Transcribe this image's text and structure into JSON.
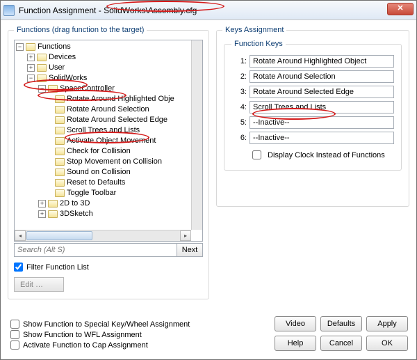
{
  "window": {
    "title_prefix": "Function Assignment - ",
    "title_path": "SolidWorks\\Assembly.cfg",
    "close_glyph": "✕"
  },
  "left": {
    "legend": "Functions (drag function to the target)",
    "tree_root": "Functions",
    "nodes": {
      "devices": "Devices",
      "user": "User",
      "solidworks": "SolidWorks",
      "spacecontroller": "SpaceController",
      "2dto3d": "2D to 3D",
      "3dsketch": "3DSketch"
    },
    "sc_children": [
      "Rotate Around Highlighted Obje",
      "Rotate Around Selection",
      "Rotate Around Selected Edge",
      "Scroll Trees and Lists",
      "Activate Object Movement",
      "Check for Collision",
      "Stop Movement on Collision",
      "Sound on Collision",
      "Reset to Defaults",
      "Toggle Toolbar"
    ],
    "search_placeholder": "Search (Alt S)",
    "next_label": "Next",
    "filter_label": "Filter Function List",
    "edit_label": "Edit …"
  },
  "right": {
    "legend": "Keys Assignment",
    "sublegend": "Function Keys",
    "keys": [
      "Rotate Around Highlighted Object",
      "Rotate Around Selection",
      "Rotate Around Selected Edge",
      "Scroll Trees and Lists",
      "--Inactive--",
      "--Inactive--"
    ],
    "display_clock": "Display Clock Instead of Functions"
  },
  "bottom": {
    "c1": "Show Function to Special Key/Wheel Assignment",
    "c2": "Show Function to WFL Assignment",
    "c3": "Activate Function to Cap Assignment"
  },
  "buttons": {
    "video": "Video",
    "defaults": "Defaults",
    "apply": "Apply",
    "help": "Help",
    "cancel": "Cancel",
    "ok": "OK"
  }
}
